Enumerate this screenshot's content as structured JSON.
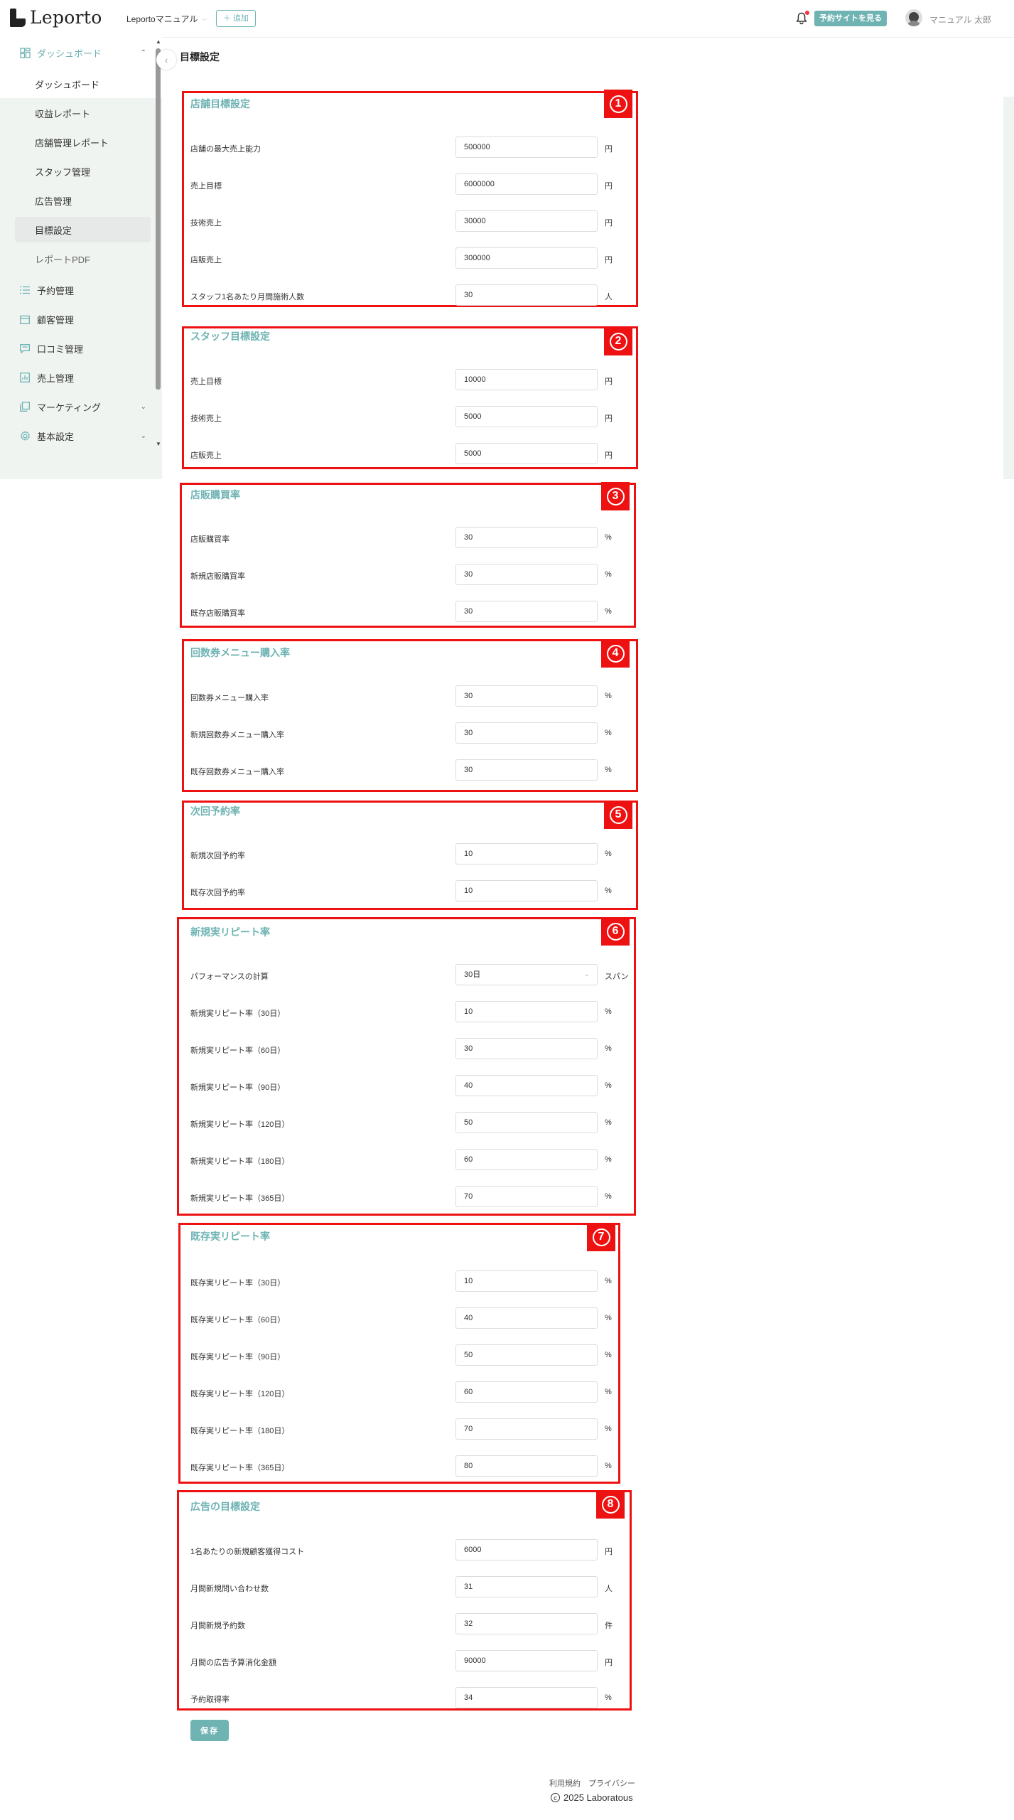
{
  "header": {
    "logo_text": "Leporto",
    "workspace": "Leportoマニュアル",
    "add_label": "＋ 追加",
    "reserve_site_label": "予約サイトを見る",
    "user_name": "マニュアル 太郎"
  },
  "sidebar": {
    "dashboard_group": "ダッシュボード",
    "sub_items": [
      "ダッシュボード",
      "収益レポート",
      "店舗管理レポート",
      "スタッフ管理",
      "広告管理",
      "目標設定",
      "レポートPDF"
    ],
    "items": [
      "予約管理",
      "顧客管理",
      "口コミ管理",
      "売上管理",
      "マーケティング",
      "基本設定"
    ]
  },
  "page": {
    "title": "目標設定"
  },
  "sections": [
    {
      "title": "店舗目標設定",
      "badge": "1",
      "rows": [
        {
          "label": "店舗の最大売上能力",
          "value": "500000",
          "unit": "円"
        },
        {
          "label": "売上目標",
          "value": "6000000",
          "unit": "円"
        },
        {
          "label": "技術売上",
          "value": "30000",
          "unit": "円"
        },
        {
          "label": "店販売上",
          "value": "300000",
          "unit": "円"
        },
        {
          "label": "スタッフ1名あたり月間施術人数",
          "value": "30",
          "unit": "人"
        }
      ]
    },
    {
      "title": "スタッフ目標設定",
      "badge": "2",
      "rows": [
        {
          "label": "売上目標",
          "value": "10000",
          "unit": "円"
        },
        {
          "label": "技術売上",
          "value": "5000",
          "unit": "円"
        },
        {
          "label": "店販売上",
          "value": "5000",
          "unit": "円"
        }
      ]
    },
    {
      "title": "店販購買率",
      "badge": "3",
      "rows": [
        {
          "label": "店販購買率",
          "value": "30",
          "unit": "%"
        },
        {
          "label": "新規店販購買率",
          "value": "30",
          "unit": "%"
        },
        {
          "label": "既存店販購買率",
          "value": "30",
          "unit": "%"
        }
      ]
    },
    {
      "title": "回数券メニュー購入率",
      "badge": "4",
      "rows": [
        {
          "label": "回数券メニュー購入率",
          "value": "30",
          "unit": "%"
        },
        {
          "label": "新規回数券メニュー購入率",
          "value": "30",
          "unit": "%"
        },
        {
          "label": "既存回数券メニュー購入率",
          "value": "30",
          "unit": "%"
        }
      ]
    },
    {
      "title": "次回予約率",
      "badge": "5",
      "rows": [
        {
          "label": "新規次回予約率",
          "value": "10",
          "unit": "%"
        },
        {
          "label": "既存次回予約率",
          "value": "10",
          "unit": "%"
        }
      ]
    },
    {
      "title": "新規実リピート率",
      "badge": "6",
      "rows": [
        {
          "label": "パフォーマンスの計算",
          "value": "30日",
          "unit": "スパン",
          "select": true
        },
        {
          "label": "新規実リピート率（30日）",
          "value": "10",
          "unit": "%"
        },
        {
          "label": "新規実リピート率（60日）",
          "value": "30",
          "unit": "%"
        },
        {
          "label": "新規実リピート率（90日）",
          "value": "40",
          "unit": "%"
        },
        {
          "label": "新規実リピート率（120日）",
          "value": "50",
          "unit": "%"
        },
        {
          "label": "新規実リピート率（180日）",
          "value": "60",
          "unit": "%"
        },
        {
          "label": "新規実リピート率（365日）",
          "value": "70",
          "unit": "%"
        }
      ]
    },
    {
      "title": "既存実リピート率",
      "badge": "7",
      "rows": [
        {
          "label": "既存実リピート率（30日）",
          "value": "10",
          "unit": "%"
        },
        {
          "label": "既存実リピート率（60日）",
          "value": "40",
          "unit": "%"
        },
        {
          "label": "既存実リピート率（90日）",
          "value": "50",
          "unit": "%"
        },
        {
          "label": "既存実リピート率（120日）",
          "value": "60",
          "unit": "%"
        },
        {
          "label": "既存実リピート率（180日）",
          "value": "70",
          "unit": "%"
        },
        {
          "label": "既存実リピート率（365日）",
          "value": "80",
          "unit": "%"
        }
      ]
    },
    {
      "title": "広告の目標設定",
      "badge": "8",
      "rows": [
        {
          "label": "1名あたりの新規顧客獲得コスト",
          "value": "6000",
          "unit": "円"
        },
        {
          "label": "月間新規問い合わせ数",
          "value": "31",
          "unit": "人"
        },
        {
          "label": "月間新規予約数",
          "value": "32",
          "unit": "件"
        },
        {
          "label": "月間の広告予算消化金額",
          "value": "90000",
          "unit": "円"
        },
        {
          "label": "予約取得率",
          "value": "34",
          "unit": "%"
        }
      ]
    }
  ],
  "save_label": "保存",
  "footer": {
    "terms": "利用規約",
    "privacy": "プライバシー",
    "copyright": "2025 Laboratous"
  },
  "colors": {
    "accent": "#6fb3b3",
    "highlight_border": "#ee1111",
    "sidebar_bg": "#f0f4f1"
  }
}
